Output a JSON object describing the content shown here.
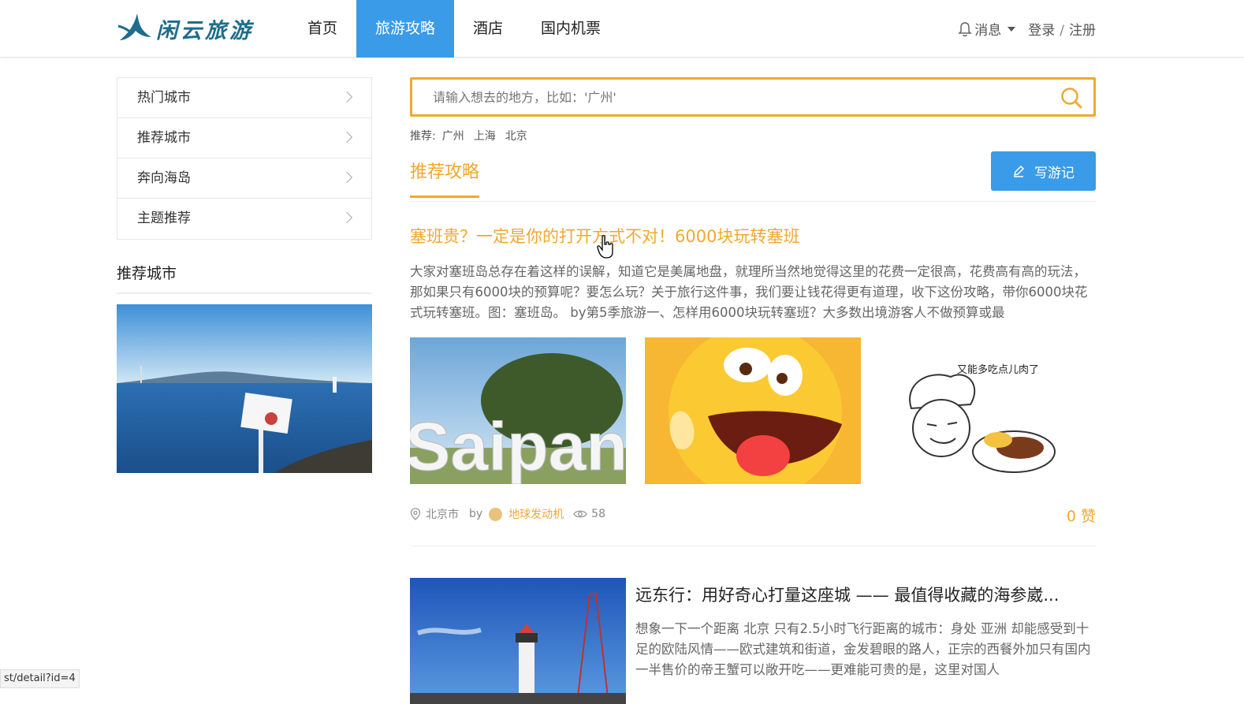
{
  "header": {
    "logo_text": "闲云旅游",
    "nav": [
      "首页",
      "旅游攻略",
      "酒店",
      "国内机票"
    ],
    "active_nav": "旅游攻略",
    "messages_label": "消息",
    "login_label": "登录",
    "separator": "/",
    "register_label": "注册"
  },
  "sidebar": {
    "menu": [
      "热门城市",
      "推荐城市",
      "奔向海岛",
      "主题推荐"
    ],
    "section_title": "推荐城市"
  },
  "search": {
    "placeholder": "请输入想去的地方，比如：'广州'"
  },
  "recommend": {
    "label": "推荐:",
    "cities": [
      "广州",
      "上海",
      "北京"
    ]
  },
  "section": {
    "title": "推荐攻略",
    "write_button": "写游记"
  },
  "article1": {
    "title": "塞班贵？一定是你的打开方式不对！6000块玩转塞班",
    "description": "大家对塞班岛总存在着这样的误解，知道它是美属地盘，就理所当然地觉得这里的花费一定很高，花费高有高的玩法，那如果只有6000块的预算呢？要怎么玩？关于旅行这件事，我们要让钱花得更有道理，收下这份攻略，带你6000块花式玩转塞班。图：塞班岛。 by第5季旅游一、怎样用6000块玩转塞班？大多数出境游客人不做预算或最",
    "image1_text": "Saipan",
    "image3_caption": "又能多吃点儿肉了",
    "location": "北京市",
    "by": "by",
    "author": "地球发动机",
    "views": "58",
    "likes": "0 赞"
  },
  "article2": {
    "title": "远东行：用好奇心打量这座城 —— 最值得收藏的海参崴...",
    "description": "想象一下一个距离 北京 只有2.5小时飞行距离的城市：身处 亚洲 却能感受到十足的欧陆风情——欧式建筑和街道，金发碧眼的路人，正宗的西餐外加只有国内一半售价的帝王蟹可以敞开吃——更难能可贵的是，这里对国人"
  },
  "status_bar": "st/detail?id=4",
  "colors": {
    "accent": "#f0a830",
    "primary": "#3a9ce8"
  }
}
